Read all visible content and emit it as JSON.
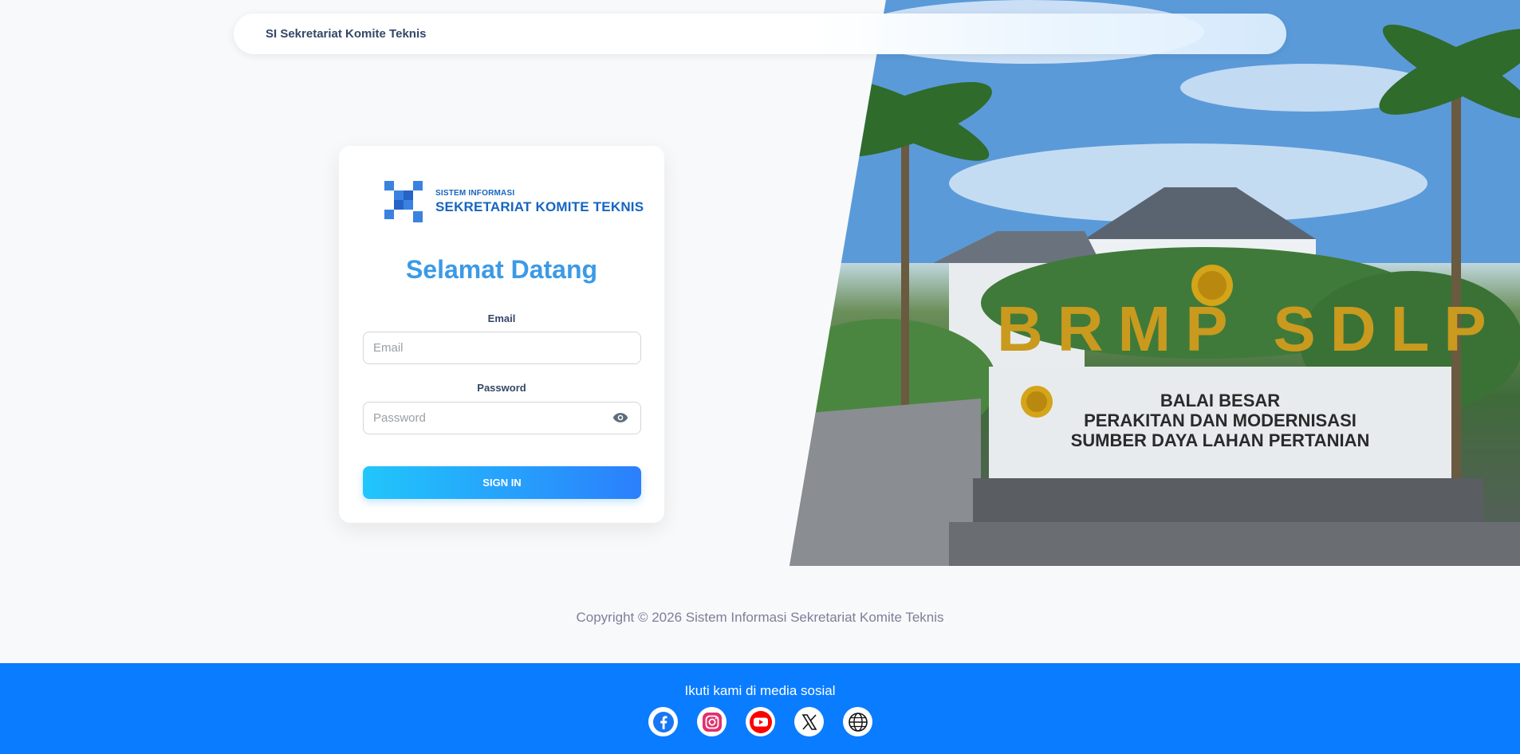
{
  "navbar": {
    "brand": "SI Sekretariat Komite Teknis"
  },
  "login": {
    "logo_small": "SISTEM INFORMASI",
    "logo_big": "SEKRETARIAT KOMITE TEKNIS",
    "welcome": "Selamat Datang",
    "email_label": "Email",
    "email_placeholder": "Email",
    "email_value": "",
    "password_label": "Password",
    "password_placeholder": "Password",
    "password_value": "",
    "signin_label": "SIGN IN"
  },
  "hero": {
    "sign_big": "BRMP SDLP",
    "sign_line1": "BALAI BESAR",
    "sign_line2": "PERAKITAN DAN MODERNISASI",
    "sign_line3": "SUMBER DAYA LAHAN PERTANIAN"
  },
  "copyright": "Copyright © 2026 Sistem Informasi Sekretariat Komite Teknis",
  "footer": {
    "follow_text": "Ikuti kami di media sosial",
    "icons": [
      "facebook-icon",
      "instagram-icon",
      "youtube-icon",
      "x-icon",
      "globe-icon"
    ]
  },
  "colors": {
    "primary": "#0a7cff",
    "welcome": "#3b9ae6",
    "logo": "#1565c0",
    "signin_start": "#21c6fb",
    "signin_end": "#2b7ffc"
  }
}
